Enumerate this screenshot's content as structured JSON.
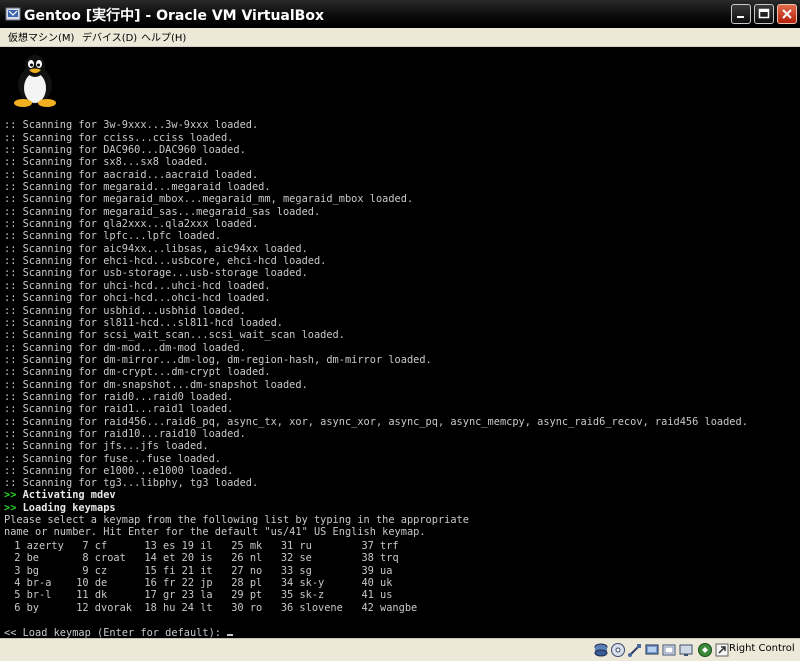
{
  "window": {
    "title": "Gentoo [実行中] - Oracle VM VirtualBox"
  },
  "menu": {
    "items": [
      {
        "label": "仮想マシン(M)"
      },
      {
        "label": "デバイス(D)"
      },
      {
        "label": "ヘルプ(H)"
      }
    ]
  },
  "console": {
    "log_lines": [
      ":: Scanning for 3w-9xxx...3w-9xxx loaded.",
      ":: Scanning for cciss...cciss loaded.",
      ":: Scanning for DAC960...DAC960 loaded.",
      ":: Scanning for sx8...sx8 loaded.",
      ":: Scanning for aacraid...aacraid loaded.",
      ":: Scanning for megaraid...megaraid loaded.",
      ":: Scanning for megaraid_mbox...megaraid_mm, megaraid_mbox loaded.",
      ":: Scanning for megaraid_sas...megaraid_sas loaded.",
      ":: Scanning for qla2xxx...qla2xxx loaded.",
      ":: Scanning for lpfc...lpfc loaded.",
      ":: Scanning for aic94xx...libsas, aic94xx loaded.",
      ":: Scanning for ehci-hcd...usbcore, ehci-hcd loaded.",
      ":: Scanning for usb-storage...usb-storage loaded.",
      ":: Scanning for uhci-hcd...uhci-hcd loaded.",
      ":: Scanning for ohci-hcd...ohci-hcd loaded.",
      ":: Scanning for usbhid...usbhid loaded.",
      ":: Scanning for sl811-hcd...sl811-hcd loaded.",
      ":: Scanning for scsi_wait_scan...scsi_wait_scan loaded.",
      ":: Scanning for dm-mod...dm-mod loaded.",
      ":: Scanning for dm-mirror...dm-log, dm-region-hash, dm-mirror loaded.",
      ":: Scanning for dm-crypt...dm-crypt loaded.",
      ":: Scanning for dm-snapshot...dm-snapshot loaded.",
      ":: Scanning for raid0...raid0 loaded.",
      ":: Scanning for raid1...raid1 loaded.",
      ":: Scanning for raid456...raid6_pq, async_tx, xor, async_xor, async_pq, async_memcpy, async_raid6_recov, raid456 loaded.",
      ":: Scanning for raid10...raid10 loaded.",
      ":: Scanning for jfs...jfs loaded.",
      ":: Scanning for fuse...fuse loaded.",
      ":: Scanning for e1000...e1000 loaded.",
      ":: Scanning for tg3...libphy, tg3 loaded."
    ],
    "status_lines": [
      {
        "marker": ">>",
        "text": "Activating mdev"
      },
      {
        "marker": ">>",
        "text": "Loading keymaps"
      }
    ],
    "instructions": [
      "Please select a keymap from the following list by typing in the appropriate",
      "name or number. Hit Enter for the default \"us/41\" US English keymap."
    ],
    "keymaps": [
      [
        " 1 azerty",
        " 7 cf",
        "13 es",
        "19 il",
        "25 mk",
        "31 ru",
        "37 trf"
      ],
      [
        " 2 be",
        " 8 croat",
        "14 et",
        "20 is",
        "26 nl",
        "32 se",
        "38 trq"
      ],
      [
        " 3 bg",
        " 9 cz",
        "15 fi",
        "21 it",
        "27 no",
        "33 sg",
        "39 ua"
      ],
      [
        " 4 br-a",
        "10 de",
        "16 fr",
        "22 jp",
        "28 pl",
        "34 sk-y",
        "40 uk"
      ],
      [
        " 5 br-l",
        "11 dk",
        "17 gr",
        "23 la",
        "29 pt",
        "35 sk-z",
        "41 us"
      ],
      [
        " 6 by",
        "12 dvorak",
        "18 hu",
        "24 lt",
        "30 ro",
        "36 slovene",
        "42 wangbe"
      ]
    ],
    "prompt": "<< Load keymap (Enter for default): "
  },
  "statusbar": {
    "host_key_label": "Right Control",
    "icons": [
      "hard-disk-icon",
      "cd-rom-icon",
      "usb-icon",
      "shared-folders-icon",
      "network-icon",
      "display-icon",
      "capture-icon",
      "seamless-icon",
      "mouse-integration-icon",
      "host-key-arrow-icon"
    ]
  }
}
